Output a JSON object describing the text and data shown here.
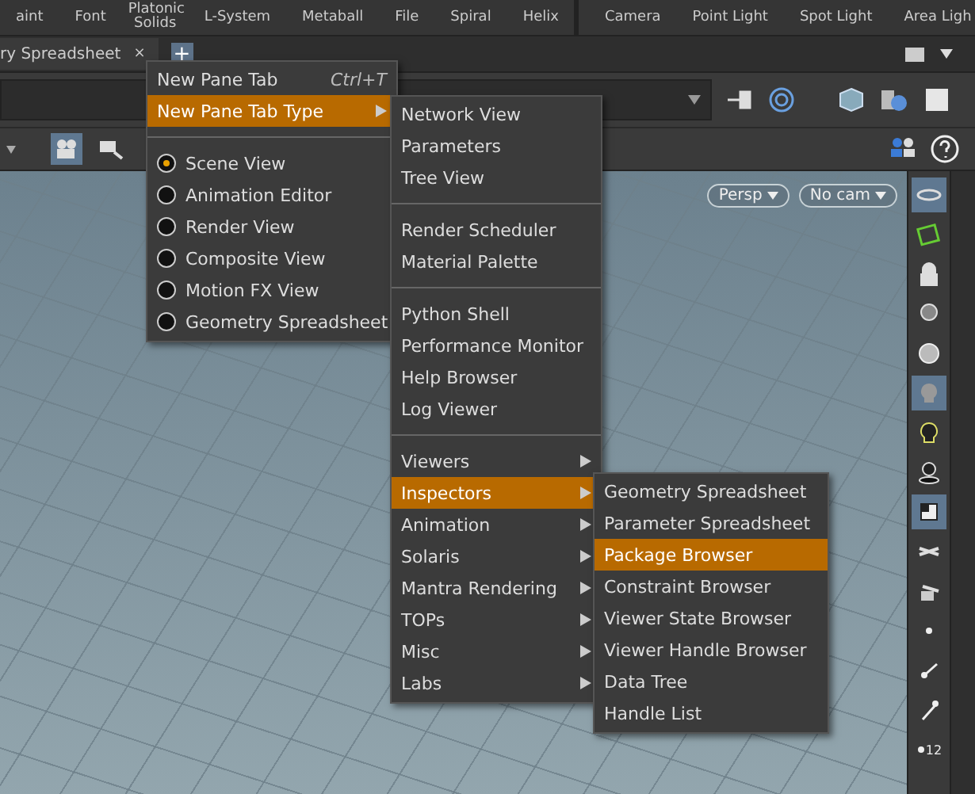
{
  "shelf": {
    "tools": [
      "aint",
      "Font",
      "Platonic Solids",
      "L-System",
      "Metaball",
      "File",
      "Spiral",
      "Helix"
    ],
    "light_tools": [
      "Camera",
      "Point Light",
      "Spot Light",
      "Area Ligh"
    ]
  },
  "tab_bar": {
    "tabs": [
      {
        "label": "ry Spreadsheet",
        "close": "×",
        "selected": true
      }
    ],
    "add": "+"
  },
  "viewport": {
    "toolbar": [
      {
        "on": true
      },
      {
        "on": false
      }
    ],
    "view_menu": "Persp",
    "camera_menu": "No cam"
  },
  "right_toolbar": [
    {
      "on": true
    },
    {
      "on": false
    },
    {
      "on": false
    },
    {
      "on": false
    },
    {
      "on": false
    },
    {
      "on": true
    },
    {
      "on": false
    },
    {
      "on": false
    },
    {
      "on": true
    },
    {
      "on": false
    },
    {
      "on": false
    },
    {
      "on": false
    },
    {
      "on": false
    },
    {
      "on": false
    },
    {
      "on": false,
      "label": "12"
    }
  ],
  "menus": [
    {
      "items": [
        {
          "kind": "item",
          "label": "New Pane Tab",
          "shortcut": "Ctrl+T",
          "selected": false
        },
        {
          "kind": "submenu",
          "label": "New Pane Tab Type",
          "selected": true
        },
        {
          "kind": "separator"
        },
        {
          "kind": "radio",
          "label": "Scene View",
          "checked": true
        },
        {
          "kind": "radio",
          "label": "Animation Editor",
          "checked": false
        },
        {
          "kind": "radio",
          "label": "Render View",
          "checked": false
        },
        {
          "kind": "radio",
          "label": "Composite View",
          "checked": false
        },
        {
          "kind": "radio",
          "label": "Motion FX View",
          "checked": false
        },
        {
          "kind": "radio",
          "label": "Geometry Spreadsheet",
          "checked": false
        }
      ]
    },
    {
      "items": [
        {
          "kind": "item",
          "label": "Network View",
          "selected": false
        },
        {
          "kind": "item",
          "label": "Parameters",
          "selected": false
        },
        {
          "kind": "item",
          "label": "Tree View",
          "selected": false
        },
        {
          "kind": "separator"
        },
        {
          "kind": "item",
          "label": "Render Scheduler",
          "selected": false
        },
        {
          "kind": "item",
          "label": "Material Palette",
          "selected": false
        },
        {
          "kind": "separator"
        },
        {
          "kind": "item",
          "label": "Python Shell",
          "selected": false
        },
        {
          "kind": "item",
          "label": "Performance Monitor",
          "selected": false
        },
        {
          "kind": "item",
          "label": "Help Browser",
          "selected": false
        },
        {
          "kind": "item",
          "label": "Log Viewer",
          "selected": false
        },
        {
          "kind": "separator"
        },
        {
          "kind": "submenu",
          "label": "Viewers",
          "selected": false
        },
        {
          "kind": "submenu",
          "label": "Inspectors",
          "selected": true
        },
        {
          "kind": "submenu",
          "label": "Animation",
          "selected": false
        },
        {
          "kind": "submenu",
          "label": "Solaris",
          "selected": false
        },
        {
          "kind": "submenu",
          "label": "Mantra Rendering",
          "selected": false
        },
        {
          "kind": "submenu",
          "label": "TOPs",
          "selected": false
        },
        {
          "kind": "submenu",
          "label": "Misc",
          "selected": false
        },
        {
          "kind": "submenu",
          "label": "Labs",
          "selected": false
        }
      ]
    },
    {
      "items": [
        {
          "kind": "item",
          "label": "Geometry Spreadsheet",
          "selected": false
        },
        {
          "kind": "item",
          "label": "Parameter Spreadsheet",
          "selected": false
        },
        {
          "kind": "item",
          "label": "Package Browser",
          "selected": true
        },
        {
          "kind": "item",
          "label": "Constraint Browser",
          "selected": false
        },
        {
          "kind": "item",
          "label": "Viewer State Browser",
          "selected": false
        },
        {
          "kind": "item",
          "label": "Viewer Handle Browser",
          "selected": false
        },
        {
          "kind": "item",
          "label": "Data Tree",
          "selected": false
        },
        {
          "kind": "item",
          "label": "Handle List",
          "selected": false
        }
      ]
    }
  ]
}
